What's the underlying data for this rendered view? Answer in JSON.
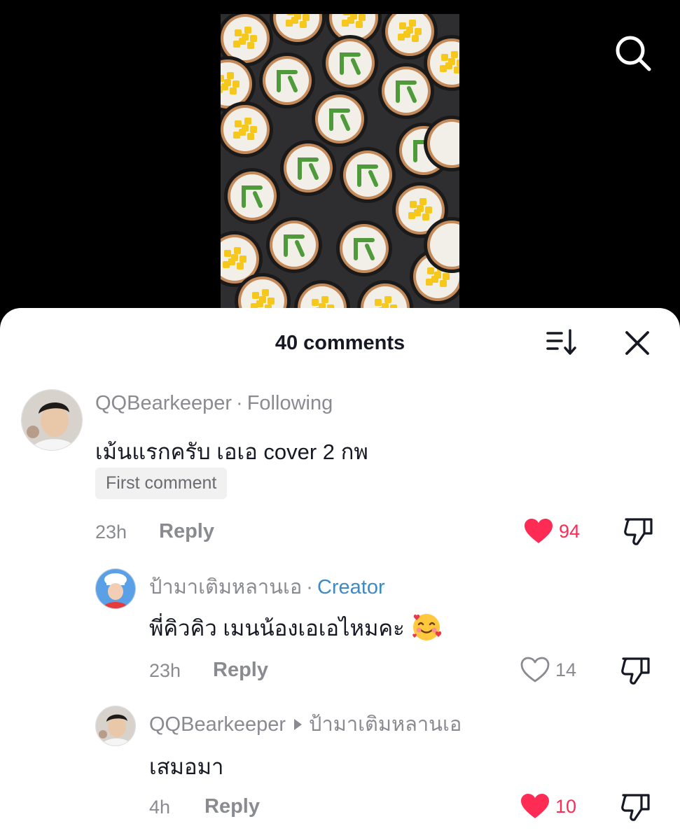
{
  "header": {
    "comments_title": "40 comments"
  },
  "icons": {
    "search": "search-icon",
    "sort": "sort-icon",
    "close": "close-icon",
    "like": "heart-icon",
    "dislike": "thumbs-down-icon"
  },
  "colors": {
    "liked": "#fe2c55",
    "creator": "#3d8bc4",
    "muted": "#8a8b91"
  },
  "comments": [
    {
      "username": "QQBearkeeper",
      "separator": "·",
      "tag": "Following",
      "text": "เม้นแรกครับ เอเอ cover 2 กพ",
      "badge": "First comment",
      "time": "23h",
      "reply_label": "Reply",
      "likes": "94",
      "liked": true
    },
    {
      "username": "ป้ามาเติมหลานเอ",
      "separator": "·",
      "tag": "Creator",
      "text": "พี่คิวคิว เมนน้องเอเอไหมคะ",
      "time": "23h",
      "reply_label": "Reply",
      "likes": "14",
      "liked": false
    },
    {
      "username": "QQBearkeeper",
      "reply_to": "ป้ามาเติมหลานเอ",
      "text": "เสมอมา",
      "time": "4h",
      "reply_label": "Reply",
      "likes": "10",
      "liked": true
    }
  ]
}
